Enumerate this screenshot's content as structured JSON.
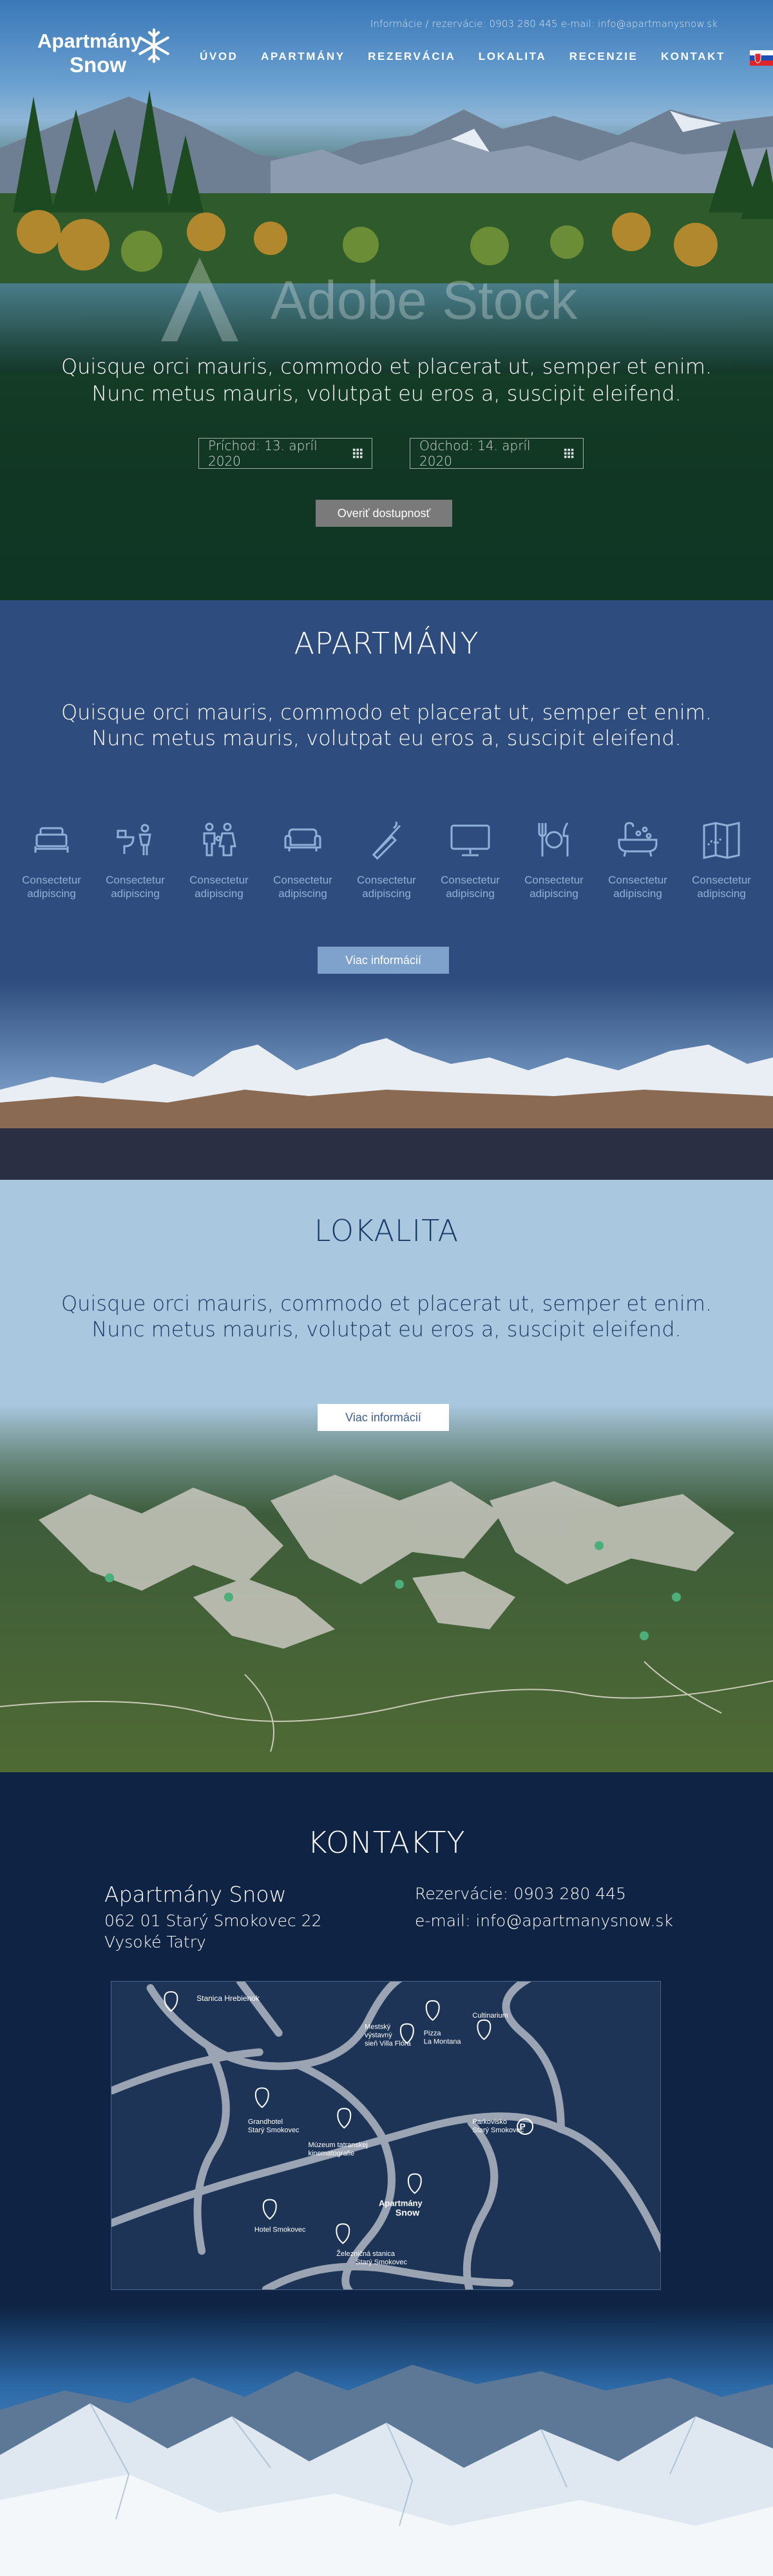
{
  "topbar": {
    "contact_line": "Informácie / rezervácie: 0903 280 445 e-mail: info@apartmanysnow.sk"
  },
  "logo": {
    "line1": "Apartmány",
    "line2": "Snow"
  },
  "nav": {
    "items": [
      "ÚVOD",
      "APARTMÁNY",
      "REZERVÁCIA",
      "LOKALITA",
      "RECENZIE",
      "KONTAKT"
    ],
    "language": "sk-flag-icon"
  },
  "hero": {
    "watermark": "Adobe Stock",
    "text_line1": "Quisque orci mauris, commodo et placerat ut, semper et enim.",
    "text_line2": "Nunc metus mauris, volutpat eu eros a, suscipit eleifend.",
    "arrival": "Príchod: 13. apríl 2020",
    "departure": "Odchod: 14. apríl 2020",
    "verify_button": "Overiť dostupnosť"
  },
  "apartments": {
    "title": "APARTMÁNY",
    "text_line1": "Quisque orci mauris, commodo et placerat ut, semper et enim.",
    "text_line2": "Nunc metus mauris, volutpat eu eros a, suscipit eleifend.",
    "features": [
      {
        "icon": "bed-icon",
        "line1": "Consectetur",
        "line2": "adipiscing"
      },
      {
        "icon": "wc-icon",
        "line1": "Consectetur",
        "line2": "adipiscing"
      },
      {
        "icon": "family-icon",
        "line1": "Consectetur",
        "line2": "adipiscing"
      },
      {
        "icon": "sofa-icon",
        "line1": "Consectetur",
        "line2": "adipiscing"
      },
      {
        "icon": "no-smoking-icon",
        "line1": "Consectetur",
        "line2": "adipiscing"
      },
      {
        "icon": "tv-icon",
        "line1": "Consectetur",
        "line2": "adipiscing"
      },
      {
        "icon": "restaurant-icon",
        "line1": "Consectetur",
        "line2": "adipiscing"
      },
      {
        "icon": "bathtub-icon",
        "line1": "Consectetur",
        "line2": "adipiscing"
      },
      {
        "icon": "map-icon",
        "line1": "Consectetur",
        "line2": "adipiscing"
      }
    ],
    "more_button": "Viac informácií"
  },
  "location": {
    "title": "LOKALITA",
    "text_line1": "Quisque orci mauris, commodo et placerat ut, semper et enim.",
    "text_line2": "Nunc metus mauris, volutpat eu eros a, suscipit eleifend.",
    "more_button": "Viac informácií"
  },
  "contacts": {
    "title": "KONTAKTY",
    "name": "Apartmány Snow",
    "address_line1": "062 01 Starý Smokovec 22",
    "address_line2": "Vysoké Tatry",
    "phone": "Rezervácie: 0903 280 445",
    "email": "e-mail: info@apartmanysnow.sk",
    "map_labels": {
      "hrebienok": "Stanica Hrebienok",
      "vystavny_line1": "Mestský",
      "vystavny_line2": "výstavný",
      "vystavny_line3": "sieň Villa Flóra",
      "pizza_line1": "Pizza",
      "pizza_line2": "La Montana",
      "cultinarium": "Cultinarium",
      "grandhotel_line1": "Grandhotel",
      "grandhotel_line2": "Starý Smokovec",
      "muzeum": "Múzeum tatranskej",
      "muzeum2": "kinematografie",
      "parkovisko_line1": "Parkovisko",
      "parkovisko_line2": "Starý Smokovec",
      "logo_line1": "Apartmány",
      "logo_line2": "Snow",
      "hotel": "Hotel Smokovec",
      "zeleznicna_line1": "Železničná stanica",
      "zeleznicna_line2": "Starý Smokovec"
    }
  },
  "colors": {
    "apartments_bg": "#2e4d7e",
    "location_bg": "#a9c7df",
    "contacts_bg": "#0f2444",
    "feature_icon": "#8fb0d8"
  }
}
